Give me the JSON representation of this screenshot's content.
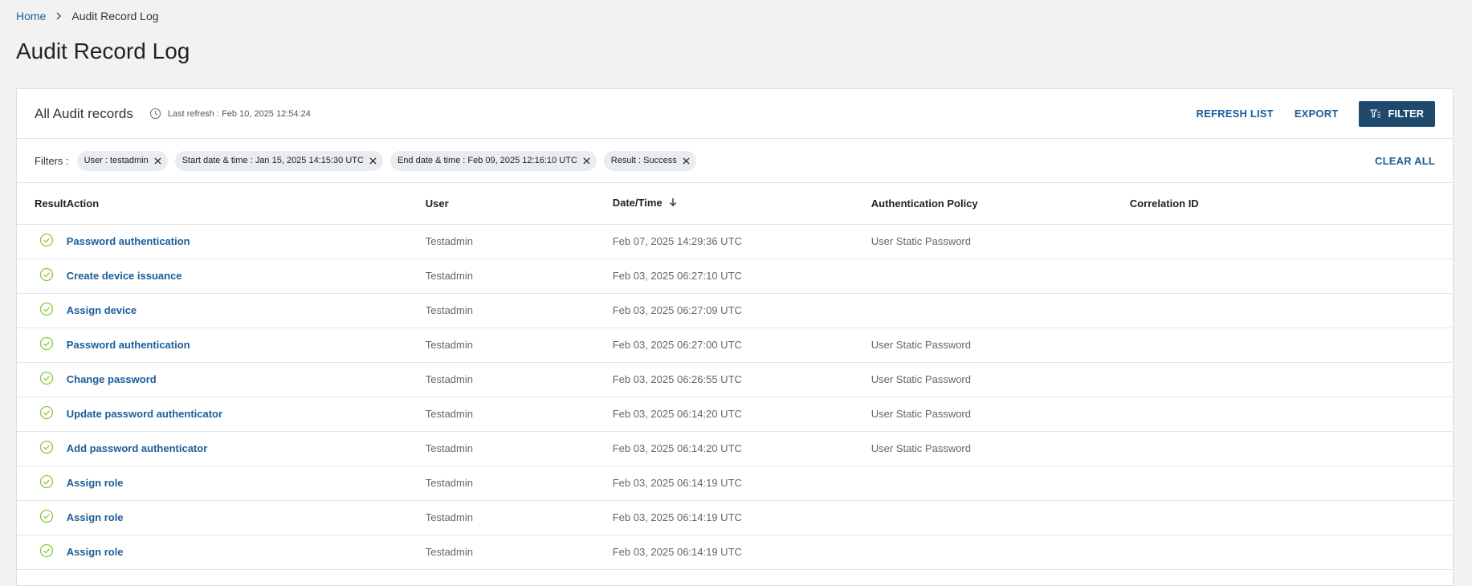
{
  "breadcrumb": {
    "home": "Home",
    "current": "Audit Record Log"
  },
  "page": {
    "title": "Audit Record Log"
  },
  "panel": {
    "title": "All Audit records",
    "last_refresh": "Last refresh : Feb 10, 2025 12:54:24",
    "refresh_label": "REFRESH LIST",
    "export_label": "EXPORT",
    "filter_label": "FILTER"
  },
  "filters": {
    "label": "Filters :",
    "chips": [
      "User : testadmin",
      "Start date & time : Jan 15, 2025 14:15:30 UTC",
      "End date & time : Feb 09, 2025 12:16:10 UTC",
      "Result : Success"
    ],
    "clear_all": "CLEAR ALL"
  },
  "table": {
    "columns": {
      "result": "Result",
      "action": "Action",
      "user": "User",
      "date": "Date/Time",
      "auth": "Authentication Policy",
      "corr": "Correlation ID"
    },
    "rows": [
      {
        "action": "Password authentication",
        "user": "Testadmin",
        "date": "Feb 07, 2025 14:29:36 UTC",
        "auth": "User Static Password",
        "corr": ""
      },
      {
        "action": "Create device issuance",
        "user": "Testadmin",
        "date": "Feb 03, 2025 06:27:10 UTC",
        "auth": "",
        "corr": ""
      },
      {
        "action": "Assign device",
        "user": "Testadmin",
        "date": "Feb 03, 2025 06:27:09 UTC",
        "auth": "",
        "corr": ""
      },
      {
        "action": "Password authentication",
        "user": "Testadmin",
        "date": "Feb 03, 2025 06:27:00 UTC",
        "auth": "User Static Password",
        "corr": ""
      },
      {
        "action": "Change password",
        "user": "Testadmin",
        "date": "Feb 03, 2025 06:26:55 UTC",
        "auth": "User Static Password",
        "corr": ""
      },
      {
        "action": "Update password authenticator",
        "user": "Testadmin",
        "date": "Feb 03, 2025 06:14:20 UTC",
        "auth": "User Static Password",
        "corr": ""
      },
      {
        "action": "Add password authenticator",
        "user": "Testadmin",
        "date": "Feb 03, 2025 06:14:20 UTC",
        "auth": "User Static Password",
        "corr": ""
      },
      {
        "action": "Assign role",
        "user": "Testadmin",
        "date": "Feb 03, 2025 06:14:19 UTC",
        "auth": "",
        "corr": ""
      },
      {
        "action": "Assign role",
        "user": "Testadmin",
        "date": "Feb 03, 2025 06:14:19 UTC",
        "auth": "",
        "corr": ""
      },
      {
        "action": "Assign role",
        "user": "Testadmin",
        "date": "Feb 03, 2025 06:14:19 UTC",
        "auth": "",
        "corr": ""
      }
    ]
  },
  "icons": {
    "result": "success-check-icon",
    "clock": "clock-icon",
    "sort": "arrow-down-icon",
    "filter": "filter-icon",
    "chip_close": "close-icon",
    "breadcrumb_sep": "chevron-right-icon"
  },
  "colors": {
    "link": "#1a5e9a",
    "primary_button": "#1f4a6e",
    "success": "#8cc63f",
    "chip_bg": "#e9edf1"
  }
}
